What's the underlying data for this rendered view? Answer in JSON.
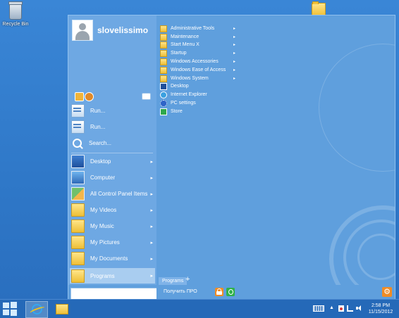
{
  "desktop": {
    "recycle_bin_label": "Recycle Bin"
  },
  "start_menu": {
    "username": "slovelissimo",
    "left_items": [
      {
        "label": "Run...",
        "icon": "run-icon",
        "arrow": false
      },
      {
        "label": "Run...",
        "icon": "run-icon",
        "arrow": false
      },
      {
        "label": "Search...",
        "icon": "search-icon",
        "arrow": false
      },
      {
        "label": "Desktop",
        "icon": "desktop-icon",
        "arrow": true
      },
      {
        "label": "Computer",
        "icon": "computer-icon",
        "arrow": true
      },
      {
        "label": "All Control Panel Items",
        "icon": "control-panel-icon",
        "arrow": true
      },
      {
        "label": "My Videos",
        "icon": "folder-icon",
        "arrow": true
      },
      {
        "label": "My Music",
        "icon": "folder-icon",
        "arrow": true
      },
      {
        "label": "My Pictures",
        "icon": "folder-icon",
        "arrow": true
      },
      {
        "label": "My Documents",
        "icon": "folder-icon",
        "arrow": true
      },
      {
        "label": "Programs",
        "icon": "folder-icon",
        "arrow": true,
        "selected": true
      }
    ],
    "arrow_glyph": "▸",
    "programs": [
      {
        "label": "Administrative Tools",
        "icon": "folder-icon",
        "submenu": true
      },
      {
        "label": "Maintenance",
        "icon": "folder-icon",
        "submenu": true
      },
      {
        "label": "Start Menu X",
        "icon": "folder-icon",
        "submenu": true
      },
      {
        "label": "Startup",
        "icon": "folder-icon",
        "submenu": true
      },
      {
        "label": "Windows Accessories",
        "icon": "folder-icon",
        "submenu": true
      },
      {
        "label": "Windows Ease of Access",
        "icon": "folder-icon",
        "submenu": true
      },
      {
        "label": "Windows System",
        "icon": "folder-icon",
        "submenu": true
      },
      {
        "label": "Desktop",
        "icon": "desktop-icon",
        "submenu": false
      },
      {
        "label": "Internet Explorer",
        "icon": "ie-icon",
        "submenu": false
      },
      {
        "label": "PC settings",
        "icon": "pc-settings-icon",
        "submenu": false
      },
      {
        "label": "Store",
        "icon": "store-icon",
        "submenu": false
      }
    ],
    "programs_tab_label": "Programs",
    "add_tab_glyph": "+",
    "get_pro_label": "Получить ПРО",
    "search_placeholder": ""
  },
  "taskbar": {
    "time": "2:58 PM",
    "date": "11/15/2012",
    "tray_up_glyph": "▲"
  },
  "colors": {
    "desktop": "#2f7fd0",
    "menu_left": "#6ea8e3",
    "menu_right": "#5f9fdd",
    "selected": "#a9cdf0",
    "accent_orange": "#f08c25",
    "accent_green": "#2fb14a"
  }
}
